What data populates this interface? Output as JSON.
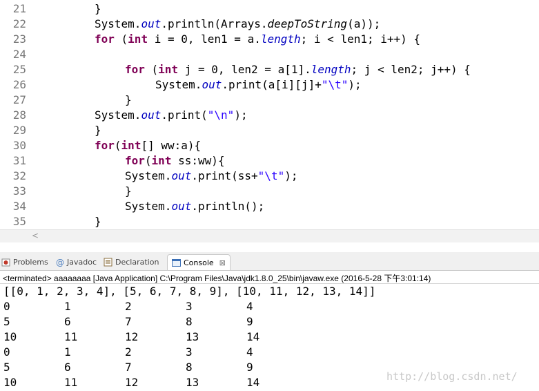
{
  "editor": {
    "lines": [
      {
        "num": "21",
        "indent": 8,
        "tokens": [
          {
            "t": "}",
            "c": ""
          }
        ]
      },
      {
        "num": "22",
        "indent": 8,
        "tokens": [
          {
            "t": "System.",
            "c": ""
          },
          {
            "t": "out",
            "c": "it"
          },
          {
            "t": ".println(Arrays.",
            "c": ""
          },
          {
            "t": "deepToString",
            "c": "st"
          },
          {
            "t": "(a));",
            "c": ""
          }
        ]
      },
      {
        "num": "23",
        "indent": 8,
        "tokens": [
          {
            "t": "for",
            "c": "kw"
          },
          {
            "t": " (",
            "c": ""
          },
          {
            "t": "int",
            "c": "kw"
          },
          {
            "t": " i = 0, len1 = a.",
            "c": ""
          },
          {
            "t": "length",
            "c": "it"
          },
          {
            "t": "; i < len1; i++) {",
            "c": ""
          }
        ]
      },
      {
        "num": "24",
        "indent": 0,
        "tokens": []
      },
      {
        "num": "25",
        "indent": 12,
        "tokens": [
          {
            "t": "for",
            "c": "kw"
          },
          {
            "t": " (",
            "c": ""
          },
          {
            "t": "int",
            "c": "kw"
          },
          {
            "t": " j = 0, len2 = a[1].",
            "c": ""
          },
          {
            "t": "length",
            "c": "it"
          },
          {
            "t": "; j < len2; j++) {",
            "c": ""
          }
        ]
      },
      {
        "num": "26",
        "indent": 16,
        "tokens": [
          {
            "t": "System.",
            "c": ""
          },
          {
            "t": "out",
            "c": "it"
          },
          {
            "t": ".print(a[i][j]+",
            "c": ""
          },
          {
            "t": "\"\\t\"",
            "c": "str"
          },
          {
            "t": ");",
            "c": ""
          }
        ]
      },
      {
        "num": "27",
        "indent": 12,
        "tokens": [
          {
            "t": "}",
            "c": ""
          }
        ]
      },
      {
        "num": "28",
        "indent": 8,
        "tokens": [
          {
            "t": "System.",
            "c": ""
          },
          {
            "t": "out",
            "c": "it"
          },
          {
            "t": ".print(",
            "c": ""
          },
          {
            "t": "\"\\n\"",
            "c": "str"
          },
          {
            "t": ");",
            "c": ""
          }
        ]
      },
      {
        "num": "29",
        "indent": 8,
        "tokens": [
          {
            "t": "}",
            "c": ""
          }
        ]
      },
      {
        "num": "30",
        "indent": 8,
        "tokens": [
          {
            "t": "for",
            "c": "kw"
          },
          {
            "t": "(",
            "c": ""
          },
          {
            "t": "int",
            "c": "kw"
          },
          {
            "t": "[] ww:a){",
            "c": ""
          }
        ]
      },
      {
        "num": "31",
        "indent": 12,
        "tokens": [
          {
            "t": "for",
            "c": "kw"
          },
          {
            "t": "(",
            "c": ""
          },
          {
            "t": "int",
            "c": "kw"
          },
          {
            "t": " ss:ww){",
            "c": ""
          }
        ]
      },
      {
        "num": "32",
        "indent": 12,
        "tokens": [
          {
            "t": "System.",
            "c": ""
          },
          {
            "t": "out",
            "c": "it"
          },
          {
            "t": ".print(ss+",
            "c": ""
          },
          {
            "t": "\"\\t\"",
            "c": "str"
          },
          {
            "t": ");",
            "c": ""
          }
        ]
      },
      {
        "num": "33",
        "indent": 12,
        "tokens": [
          {
            "t": "}",
            "c": ""
          }
        ]
      },
      {
        "num": "34",
        "indent": 12,
        "tokens": [
          {
            "t": "System.",
            "c": ""
          },
          {
            "t": "out",
            "c": "it"
          },
          {
            "t": ".println();",
            "c": ""
          }
        ]
      },
      {
        "num": "35",
        "indent": 8,
        "tokens": [
          {
            "t": "}",
            "c": ""
          }
        ]
      }
    ]
  },
  "tabs": [
    {
      "label": "Problems",
      "icon": "problems-icon",
      "active": false
    },
    {
      "label": "Javadoc",
      "icon": "javadoc-icon",
      "active": false
    },
    {
      "label": "Declaration",
      "icon": "declaration-icon",
      "active": false
    },
    {
      "label": "Console",
      "icon": "console-icon",
      "active": true,
      "close": "⊠"
    }
  ],
  "console": {
    "header": "<terminated> aaaaaaaa [Java Application] C:\\Program Files\\Java\\jdk1.8.0_25\\bin\\javaw.exe (2016-5-28 下午3:01:14)",
    "first_line": "[[0, 1, 2, 3, 4], [5, 6, 7, 8, 9], [10, 11, 12, 13, 14]]",
    "rows": [
      [
        "0",
        "1",
        "2",
        "3",
        "4"
      ],
      [
        "5",
        "6",
        "7",
        "8",
        "9"
      ],
      [
        "10",
        "11",
        "12",
        "13",
        "14"
      ],
      [
        "0",
        "1",
        "2",
        "3",
        "4"
      ],
      [
        "5",
        "6",
        "7",
        "8",
        "9"
      ],
      [
        "10",
        "11",
        "12",
        "13",
        "14"
      ]
    ]
  },
  "watermark": "http://blog.csdn.net/",
  "colors": {
    "keyword": "#7f0055",
    "field": "#0000c0",
    "string": "#2a00ff",
    "line_number": "#787878"
  }
}
